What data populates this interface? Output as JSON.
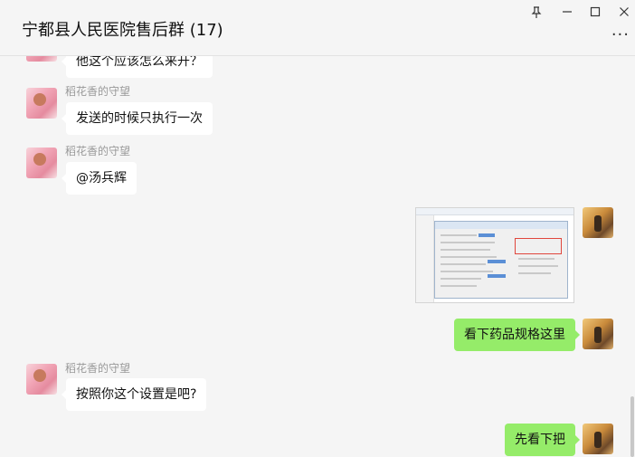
{
  "window": {
    "title": "宁都县人民医院售后群 (17)",
    "pin_glyph": "⊥",
    "minimize_glyph": "—",
    "maximize_glyph": "☐",
    "close_glyph": "✕",
    "more_glyph": "···"
  },
  "messages": [
    {
      "side": "in",
      "text": "他这个应该怎么来开？"
    },
    {
      "side": "in",
      "sender": "稻花香的守望",
      "text": "发送的时候只执行一次"
    },
    {
      "side": "in",
      "sender": "稻花香的守望",
      "text": "@汤兵辉"
    },
    {
      "side": "out",
      "type": "image",
      "icon": "screenshot-image"
    },
    {
      "side": "out",
      "text": "看下药品规格这里"
    },
    {
      "side": "in",
      "sender": "稻花香的守望",
      "text": "按照你这个设置是吧?"
    },
    {
      "side": "out",
      "text": "先看下把"
    }
  ],
  "colors": {
    "background": "#f5f5f5",
    "incoming_bubble": "#ffffff",
    "outgoing_bubble": "#95ec69",
    "sender_name": "#999999"
  }
}
